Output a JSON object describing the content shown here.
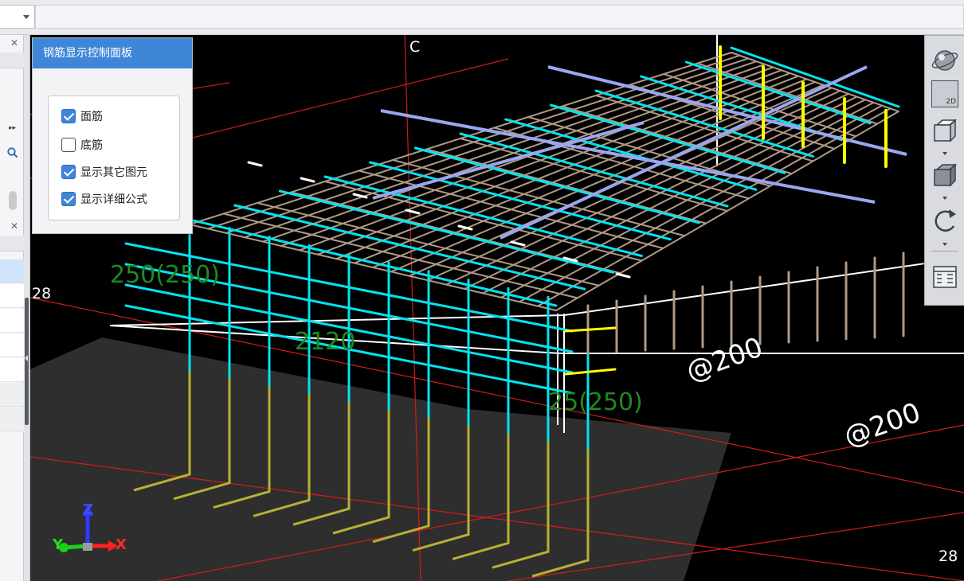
{
  "control_panel": {
    "title": "钢筋显示控制面板",
    "options": [
      {
        "label": "面筋",
        "checked": true
      },
      {
        "label": "底筋",
        "checked": false
      },
      {
        "label": "显示其它图元",
        "checked": true
      },
      {
        "label": "显示详细公式",
        "checked": true
      }
    ]
  },
  "viewport": {
    "background": "#000000",
    "rebar_colors": {
      "top_mesh": "#00e5ee",
      "side_mesh": "#b09a86",
      "distribution_bar": "#9aa6f0",
      "dowel_bar": "#b8b035",
      "highlight": "#ffff00",
      "dimension_text": "#1f8a1f",
      "grid_line": "#ff2020"
    },
    "axis_labels": {
      "c": "C",
      "left_28": "28",
      "bottom_28": "28"
    },
    "dimension_labels": {
      "a": "250(250)",
      "b": "2120",
      "c": "25(250)"
    },
    "annotation_labels": {
      "a": "@200",
      "b": "@200"
    },
    "gizmo": {
      "z": "Z",
      "y": "Y",
      "x": "X"
    }
  },
  "right_toolbar": {
    "buttons": [
      {
        "icon": "sphere-icon"
      },
      {
        "icon": "view-2d-icon",
        "text": "2D"
      },
      {
        "icon": "cube-wireframe-icon"
      },
      {
        "icon": "cube-solid-icon"
      },
      {
        "icon": "rotate-icon"
      },
      {
        "icon": "layout-icon"
      }
    ]
  }
}
